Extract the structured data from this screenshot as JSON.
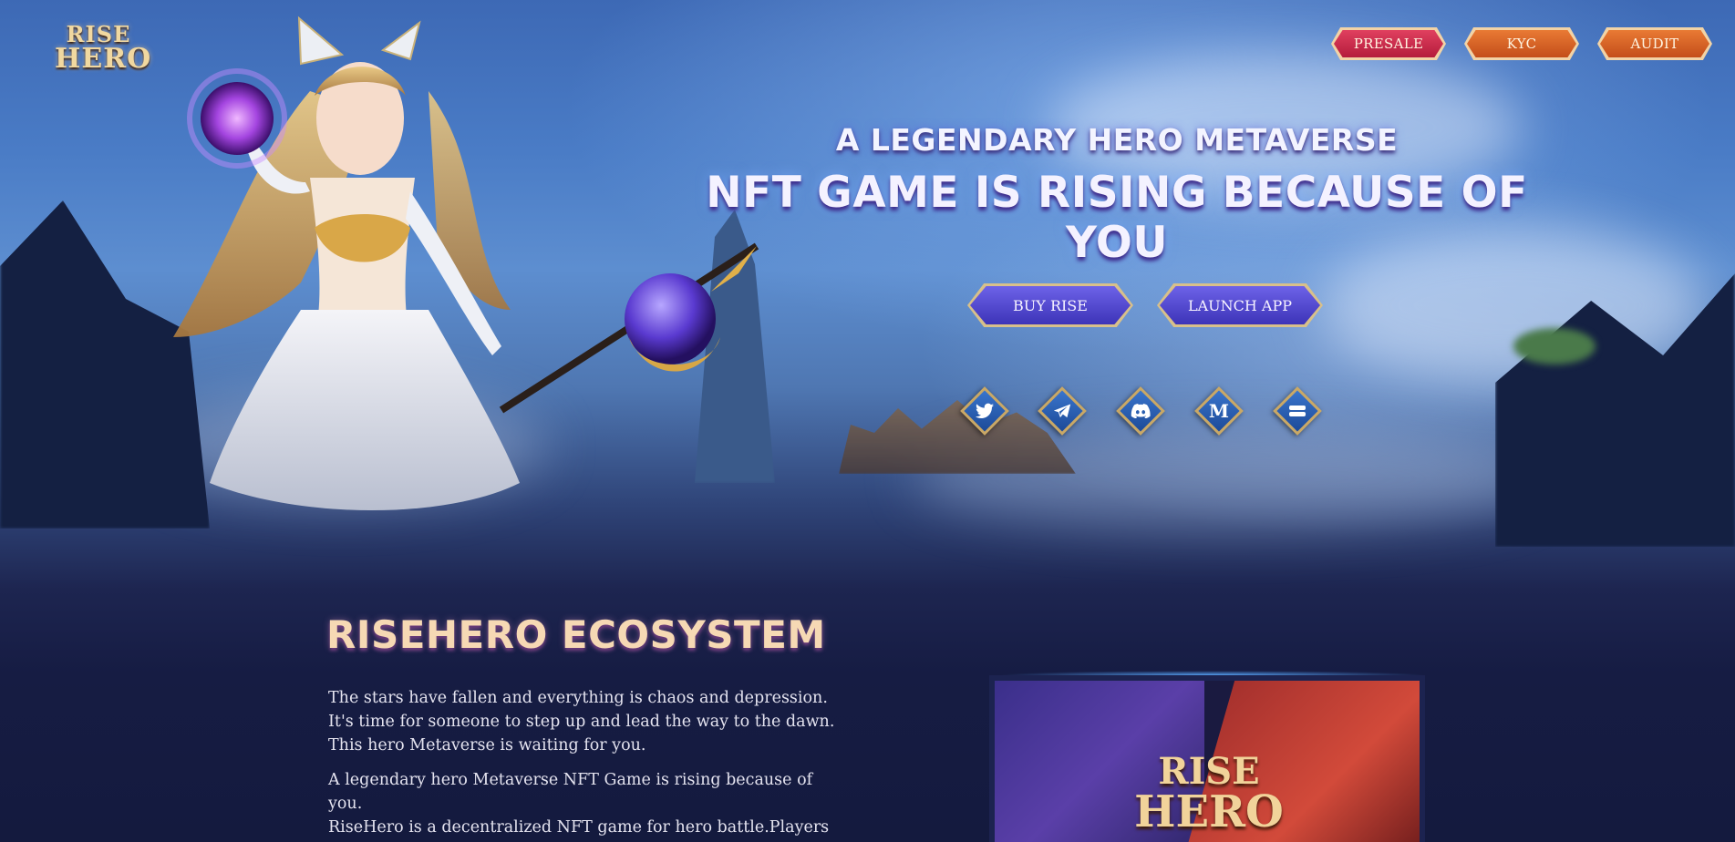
{
  "logo": {
    "line1": "RISE",
    "line2": "HERO"
  },
  "top_nav": {
    "presale": "PRESALE",
    "kyc": "KYC",
    "audit": "AUDIT"
  },
  "hero": {
    "subtitle": "A LEGENDARY HERO METAVERSE",
    "title": "NFT GAME IS RISING BECAUSE OF YOU",
    "buy_label": "BUY RISE",
    "launch_label": "LAUNCH APP"
  },
  "social": [
    {
      "icon": "twitter-icon",
      "glyph": "🐦"
    },
    {
      "icon": "telegram-icon",
      "glyph": "➤"
    },
    {
      "icon": "discord-icon",
      "glyph": "◉"
    },
    {
      "icon": "medium-icon",
      "glyph": "M"
    },
    {
      "icon": "gitbook-icon",
      "glyph": "▭"
    }
  ],
  "ecosystem": {
    "title": "RISEHERO ECOSYSTEM",
    "para1_line1": "The stars have fallen and everything is chaos and depression.",
    "para1_line2": "It's time for someone to step up and lead the way to the dawn.",
    "para1_line3": "This hero Metaverse is waiting for you.",
    "para2_line1": "A legendary hero Metaverse NFT Game is rising because of you.",
    "para2_line2": "RiseHero is a decentralized NFT game for hero battle.Players"
  },
  "thumbnail": {
    "line1": "RISE",
    "line2": "HERO"
  },
  "colors": {
    "presale": "#c9284a",
    "kyc_audit": "#d8602a",
    "action_button": "#4f46d0",
    "social": "#2a62b8",
    "gold_border": "#d8c08a",
    "page_bg": "#141a3e"
  }
}
